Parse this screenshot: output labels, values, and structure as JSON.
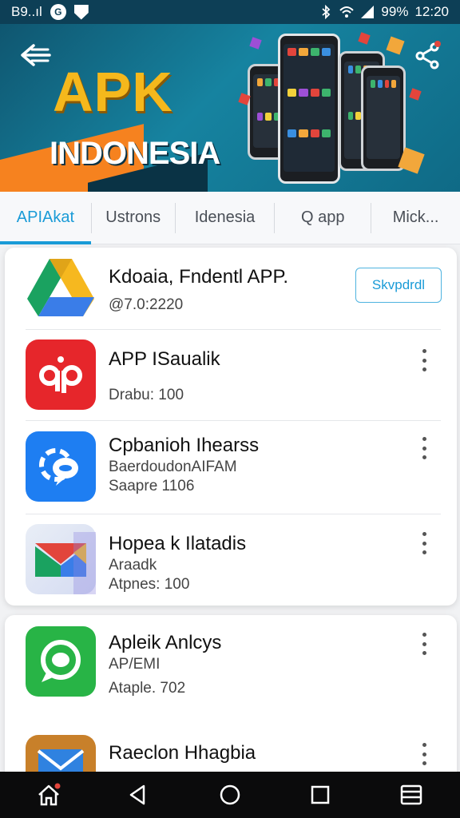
{
  "status_bar": {
    "carrier": "B9..ıl",
    "battery": "99%",
    "time": "12:20"
  },
  "header": {
    "logo_top": "APK",
    "logo_bottom": "INDONESIA"
  },
  "tabs": [
    {
      "label": "APIAkat",
      "active": true
    },
    {
      "label": "Ustrons",
      "active": false
    },
    {
      "label": "Idenesia",
      "active": false
    },
    {
      "label": "Q app",
      "active": false
    },
    {
      "label": "Mick...",
      "active": false
    }
  ],
  "apps": [
    {
      "name": "Kdoaia, Fndentl APP.",
      "line1": "@7.0:2220",
      "line2": "",
      "action": "Skvpdrdl",
      "icon": "google-drive-icon"
    },
    {
      "name": "APP ISaualik",
      "line1": "",
      "line2": "Drabu: 100",
      "icon": "red-app-icon"
    },
    {
      "name": "Cpbanioh Ihearss",
      "line1": "BaerdoudonAIFAM",
      "line2": "Saapre 1106",
      "icon": "blue-chat-icon"
    },
    {
      "name": "Hopea k Ilatadis",
      "line1": "Araadk",
      "line2": "Atpnes: 100",
      "icon": "gmail-icon"
    },
    {
      "name": "Apleik Anlcys",
      "line1": "AP/EMI",
      "line2": "Ataple. 702",
      "icon": "whatsapp-icon"
    },
    {
      "name": "Raeclon Hhagbia",
      "line1": "",
      "line2": "",
      "icon": "mail-icon"
    }
  ],
  "colors": {
    "accent": "#1a9bd7",
    "banner": "#0f5670",
    "logo_gold": "#f5b81c",
    "orange": "#f6821f"
  }
}
